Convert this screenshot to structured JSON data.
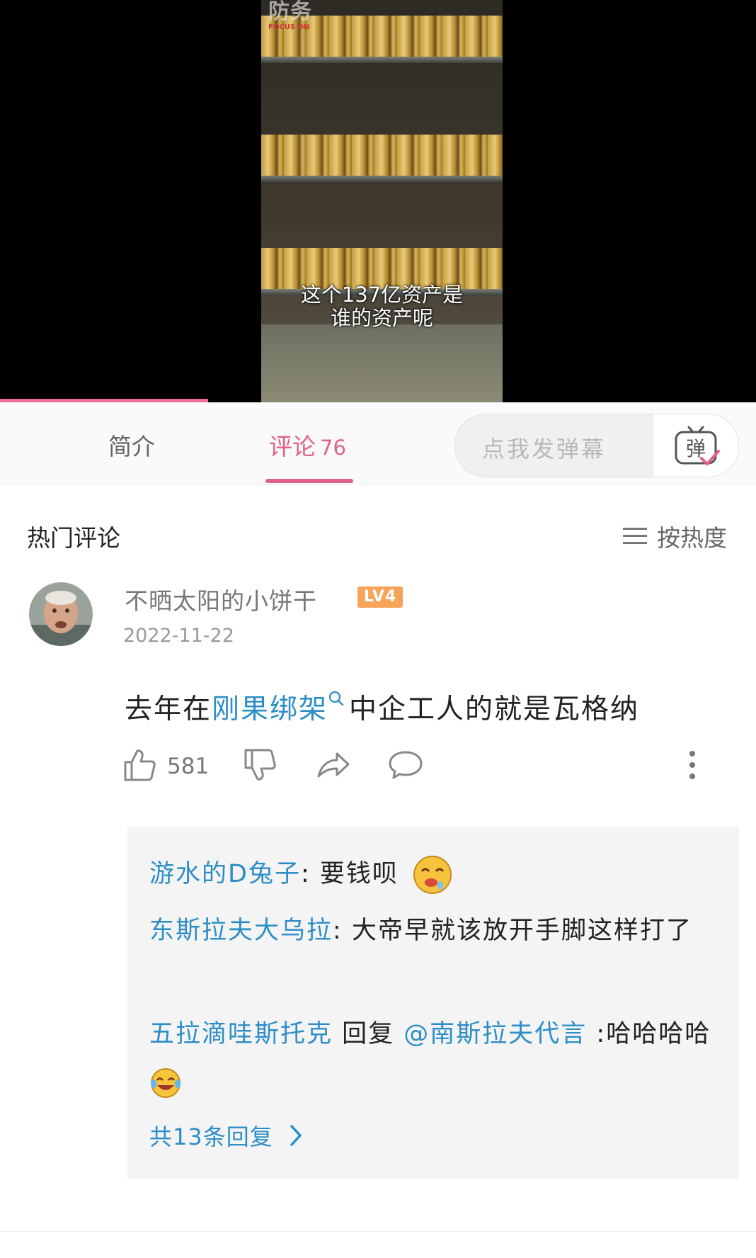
{
  "video": {
    "watermark": "防务",
    "watermark_sub": "FOCUS ON",
    "subtitle_line1": "这个137亿资产是",
    "subtitle_line2": "谁的资产呢",
    "progress_fraction": 0.275,
    "accent_color": "#f06b97"
  },
  "tabs": {
    "intro_label": "简介",
    "comments_label": "评论",
    "comments_count": "76",
    "danmaku_placeholder": "点我发弹幕",
    "danmaku_button_icon": "danmaku-tv-icon",
    "danmaku_button_glyph": "弹"
  },
  "comments_section": {
    "title": "热门评论",
    "sort_label": "按热度",
    "sort_icon": "list-sort-icon"
  },
  "comment": {
    "username": "不晒太阳的小饼干",
    "level": "LV4",
    "date": "2022-11-22",
    "text_before": "去年在",
    "text_link": "刚果绑架",
    "text_after": "中企工人的就是瓦格纳",
    "like_count": "581",
    "link_color": "#2d8ec7"
  },
  "replies": [
    {
      "name": "游水的D兔子",
      "sep": ": ",
      "text": "要钱呗",
      "emoji": "drooling-face-emoji"
    },
    {
      "name": "东斯拉夫大乌拉",
      "sep": ": ",
      "text": "大帝早就该放开手脚这样打了"
    },
    {
      "name": "五拉滴哇斯托克",
      "reply_word": " 回复 ",
      "mention": "@南斯拉夫代言",
      "sep": " :",
      "text": "哈哈哈哈",
      "emoji": "laughing-tears-emoji"
    }
  ],
  "reply_more": "共13条回复"
}
